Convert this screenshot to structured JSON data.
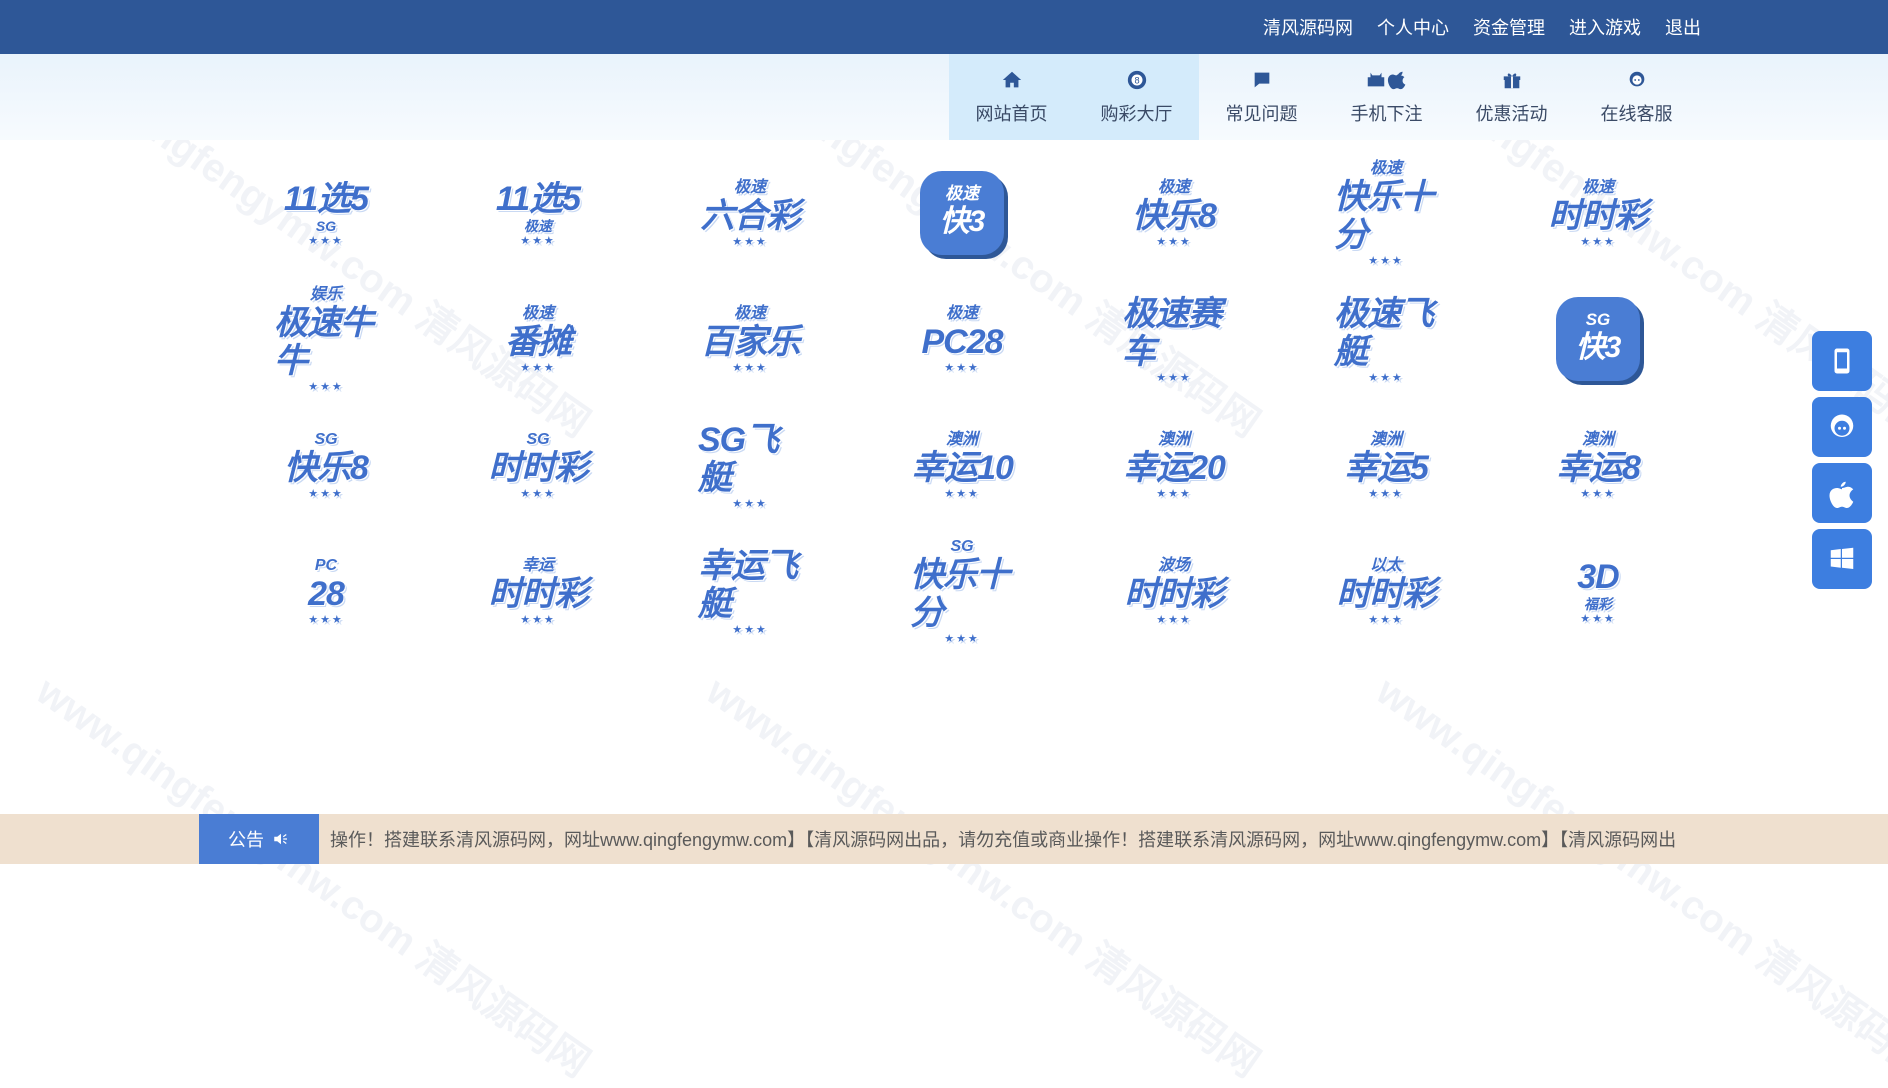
{
  "header": {
    "links": [
      "清风源码网",
      "个人中心",
      "资金管理",
      "进入游戏",
      "退出"
    ]
  },
  "nav": {
    "items": [
      {
        "label": "网站首页",
        "icon": "home-icon",
        "active": true
      },
      {
        "label": "购彩大厅",
        "icon": "ball-8-icon",
        "active": true
      },
      {
        "label": "常见问题",
        "icon": "chat-bubble-icon",
        "active": false
      },
      {
        "label": "手机下注",
        "icon": "android-apple-icon",
        "active": false
      },
      {
        "label": "优惠活动",
        "icon": "gift-icon",
        "active": false
      },
      {
        "label": "在线客服",
        "icon": "customer-service-icon",
        "active": false
      }
    ]
  },
  "games": [
    {
      "top": "",
      "main": "11选5",
      "sub": "SG",
      "style": "text"
    },
    {
      "top": "",
      "main": "11选5",
      "sub": "极速",
      "style": "text"
    },
    {
      "top": "极速",
      "main": "六合彩",
      "sub": "",
      "style": "text"
    },
    {
      "top": "极速",
      "main": "快3",
      "sub": "",
      "style": "box"
    },
    {
      "top": "极速",
      "main": "快乐8",
      "sub": "",
      "style": "text"
    },
    {
      "top": "极速",
      "main": "快乐十分",
      "sub": "",
      "style": "text"
    },
    {
      "top": "极速",
      "main": "时时彩",
      "sub": "",
      "style": "text"
    },
    {
      "top": "娱乐",
      "main": "极速牛牛",
      "sub": "",
      "style": "text"
    },
    {
      "top": "极速",
      "main": "番摊",
      "sub": "",
      "style": "text"
    },
    {
      "top": "极速",
      "main": "百家乐",
      "sub": "",
      "style": "text"
    },
    {
      "top": "极速",
      "main": "PC28",
      "sub": "",
      "style": "text"
    },
    {
      "top": "",
      "main": "极速赛车",
      "sub": "",
      "style": "text"
    },
    {
      "top": "",
      "main": "极速飞艇",
      "sub": "",
      "style": "text"
    },
    {
      "top": "SG",
      "main": "快3",
      "sub": "",
      "style": "box"
    },
    {
      "top": "SG",
      "main": "快乐8",
      "sub": "",
      "style": "text"
    },
    {
      "top": "SG",
      "main": "时时彩",
      "sub": "",
      "style": "text"
    },
    {
      "top": "",
      "main": "SG飞艇",
      "sub": "",
      "style": "text"
    },
    {
      "top": "澳洲",
      "main": "幸运10",
      "sub": "",
      "style": "text"
    },
    {
      "top": "澳洲",
      "main": "幸运20",
      "sub": "",
      "style": "text"
    },
    {
      "top": "澳洲",
      "main": "幸运5",
      "sub": "",
      "style": "text"
    },
    {
      "top": "澳洲",
      "main": "幸运8",
      "sub": "",
      "style": "text"
    },
    {
      "top": "PC",
      "main": "28",
      "sub": "",
      "style": "text"
    },
    {
      "top": "幸运",
      "main": "时时彩",
      "sub": "",
      "style": "text"
    },
    {
      "top": "",
      "main": "幸运飞艇",
      "sub": "",
      "style": "text"
    },
    {
      "top": "SG",
      "main": "快乐十分",
      "sub": "",
      "style": "text"
    },
    {
      "top": "波场",
      "main": "时时彩",
      "sub": "",
      "style": "text"
    },
    {
      "top": "以太",
      "main": "时时彩",
      "sub": "",
      "style": "text"
    },
    {
      "top": "",
      "main": "3D",
      "sub": "福彩",
      "style": "text"
    }
  ],
  "side_buttons": [
    "phone-icon",
    "customer-service-icon",
    "apple-icon",
    "windows-icon"
  ],
  "notice": {
    "label": "公告",
    "text": "操作！搭建联系清风源码网，网址www.qingfengymw.com】【清风源码网出品，请勿充值或商业操作！搭建联系清风源码网，网址www.qingfengymw.com】【清风源码网出"
  },
  "watermark": "www.qingfengymw.com 清风源码网",
  "colors": {
    "topbar": "#2e5797",
    "accent": "#3d7ee0",
    "notice_bg": "#efe0cf"
  }
}
